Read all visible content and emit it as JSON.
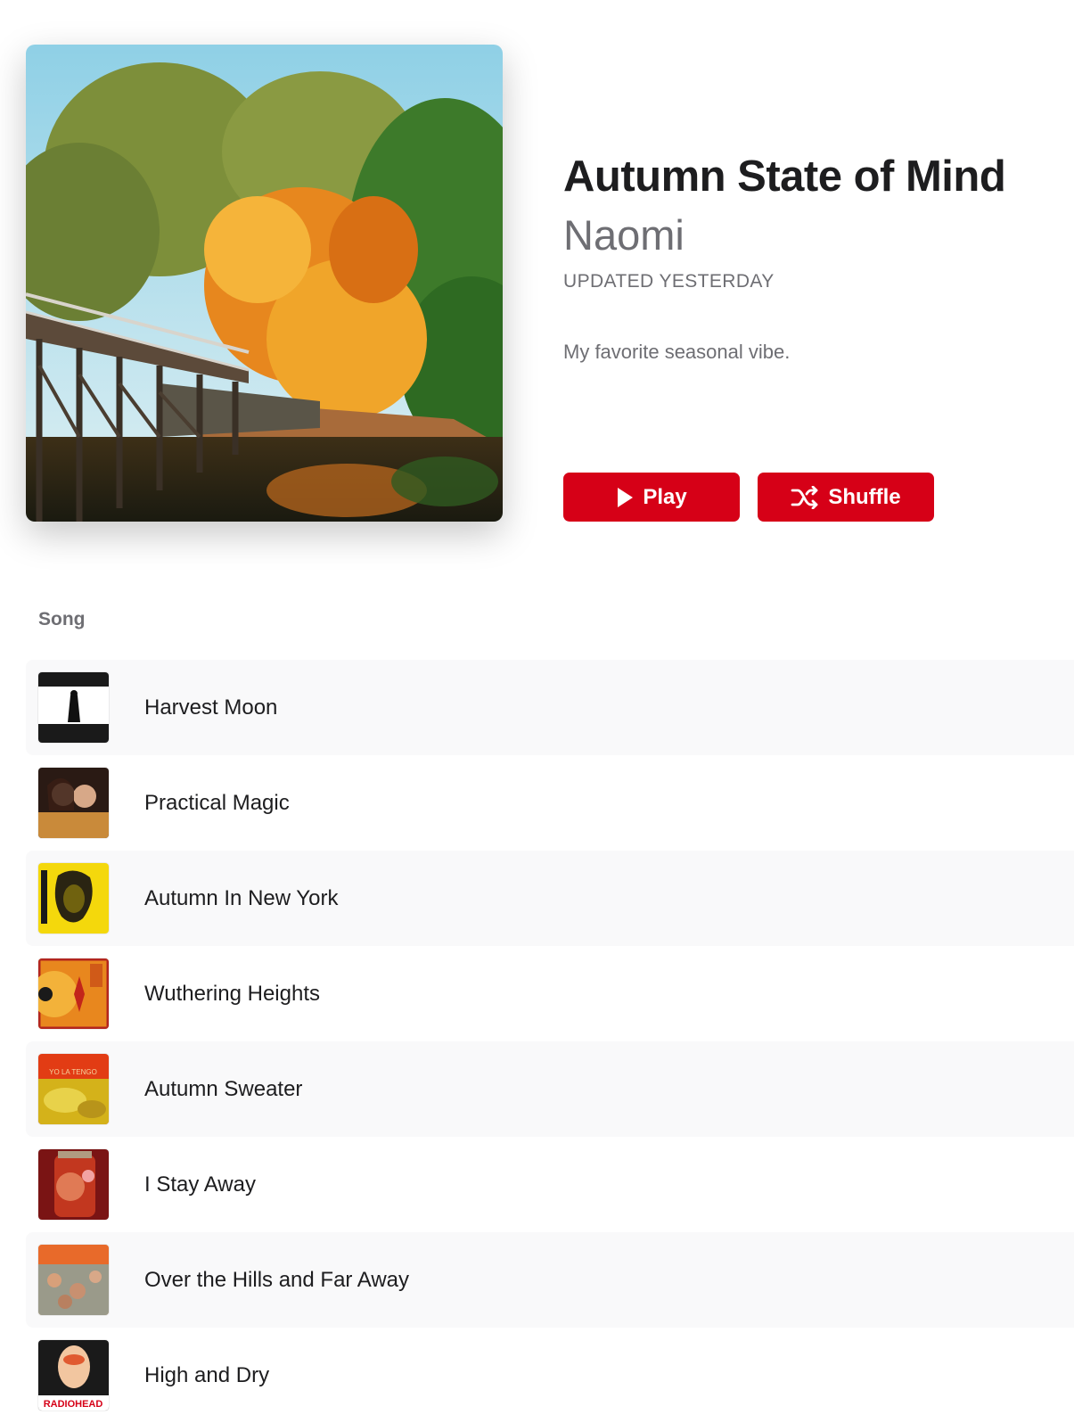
{
  "playlist": {
    "title": "Autumn State of Mind",
    "curator": "Naomi",
    "updated": "UPDATED YESTERDAY",
    "description": "My favorite seasonal vibe.",
    "artwork_icon": "autumn-bridge-artwork"
  },
  "actions": {
    "play_label": "Play",
    "play_icon": "play-icon",
    "shuffle_label": "Shuffle",
    "shuffle_icon": "shuffle-icon"
  },
  "colors": {
    "accent": "#d60017",
    "primary_text": "#1d1d1f",
    "secondary_text": "#6e6e73",
    "row_alt": "#f9f9fa"
  },
  "songs": {
    "column_header": "Song",
    "items": [
      {
        "title": "Harvest Moon",
        "art": "album-art-black-white"
      },
      {
        "title": "Practical Magic",
        "art": "album-art-practical-magic"
      },
      {
        "title": "Autumn In New York",
        "art": "album-art-yellow-portrait"
      },
      {
        "title": "Wuthering Heights",
        "art": "album-art-orange-kick-inside"
      },
      {
        "title": "Autumn Sweater",
        "art": "album-art-yo-la-tengo",
        "art_text": "YO LA TENGO"
      },
      {
        "title": "I Stay Away",
        "art": "album-art-red-jar"
      },
      {
        "title": "Over the Hills and Far Away",
        "art": "album-art-houses-of-the-holy"
      },
      {
        "title": "High and Dry",
        "art": "album-art-radiohead-bends",
        "art_text": "RADIOHEAD"
      }
    ]
  }
}
